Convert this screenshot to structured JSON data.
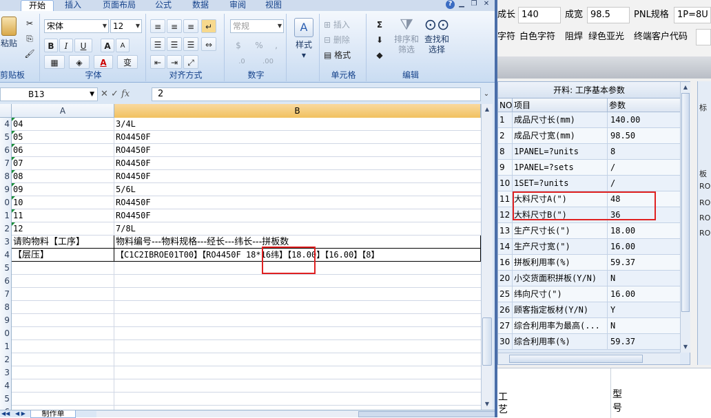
{
  "excel": {
    "ribbon_tabs": [
      "开始",
      "插入",
      "页面布局",
      "公式",
      "数据",
      "审阅",
      "视图"
    ],
    "clipboard": {
      "paste": "粘贴",
      "group": "剪贴板"
    },
    "font": {
      "name": "宋体",
      "size": "12",
      "bold": "B",
      "italic": "I",
      "underline": "U",
      "grow": "A",
      "shrink": "A",
      "font_color": "A",
      "phonetic": "变",
      "group": "字体"
    },
    "alignment": {
      "group": "对齐方式"
    },
    "number": {
      "format": "常规",
      "percent": "%",
      "comma": ",",
      "inc_decimal": ".0",
      "dec_decimal": ".00",
      "group": "数字"
    },
    "styles": {
      "label": "样式"
    },
    "cells": {
      "insert": "插入",
      "delete": "删除",
      "format": "格式",
      "group": "单元格"
    },
    "editing": {
      "sum": "Σ",
      "sort_filter": "排序和筛选",
      "find_select": "查找和选择",
      "group": "编辑"
    },
    "formula_bar": {
      "name_box": "B13",
      "fx": "fx",
      "value": "2"
    },
    "columns": [
      "A",
      "B"
    ],
    "rows": [
      {
        "num": "4",
        "a": "04",
        "b": "3/4L"
      },
      {
        "num": "5",
        "a": "05",
        "b": "RO4450F"
      },
      {
        "num": "6",
        "a": "06",
        "b": "RO4450F"
      },
      {
        "num": "7",
        "a": "07",
        "b": "RO4450F"
      },
      {
        "num": "8",
        "a": "08",
        "b": "RO4450F"
      },
      {
        "num": "9",
        "a": "09",
        "b": "5/6L"
      },
      {
        "num": "0",
        "a": "10",
        "b": "RO4450F"
      },
      {
        "num": "1",
        "a": "11",
        "b": "RO4450F"
      },
      {
        "num": "2",
        "a": "12",
        "b": "7/8L"
      },
      {
        "num": "3",
        "a": "请购物料【工序】",
        "b": "物料编号---物料规格---经长---纬长---拼板数"
      },
      {
        "num": "4",
        "a": "【层压】",
        "b": "【C1C2IBROE01T00】【RO4450F 18*16纬】【18.00】【16.00】【8】"
      },
      {
        "num": "5",
        "a": "",
        "b": ""
      },
      {
        "num": "6",
        "a": "",
        "b": ""
      },
      {
        "num": "7",
        "a": "",
        "b": ""
      },
      {
        "num": "8",
        "a": "",
        "b": ""
      },
      {
        "num": "9",
        "a": "",
        "b": ""
      },
      {
        "num": "0",
        "a": "",
        "b": ""
      },
      {
        "num": "1",
        "a": "",
        "b": ""
      },
      {
        "num": "2",
        "a": "",
        "b": ""
      },
      {
        "num": "3",
        "a": "",
        "b": ""
      },
      {
        "num": "4",
        "a": "",
        "b": ""
      },
      {
        "num": "5",
        "a": "",
        "b": ""
      },
      {
        "num": "6",
        "a": "",
        "b": ""
      }
    ],
    "sheet_tab": "制作单"
  },
  "right": {
    "fields": [
      {
        "label": "成长",
        "value": "140"
      },
      {
        "label": "成宽",
        "value": "98.5"
      },
      {
        "label": "PNL规格",
        "value": "1P=8U"
      }
    ],
    "row2": {
      "label1": "字符",
      "value1": "白色字符",
      "label2": "阻焊",
      "value2": "绿色亚光",
      "label3": "终端客户代码",
      "value3": ""
    },
    "panel_title": "开料: 工序基本参数",
    "headers": {
      "no": "NO",
      "item": "项目",
      "param": "参数"
    },
    "params": [
      {
        "no": "1",
        "item": "成品尺寸长(mm)",
        "value": "140.00"
      },
      {
        "no": "2",
        "item": "成品尺寸宽(mm)",
        "value": "98.50"
      },
      {
        "no": "8",
        "item": "1PANEL=?units",
        "value": "8"
      },
      {
        "no": "9",
        "item": "1PANEL=?sets",
        "value": "/"
      },
      {
        "no": "10",
        "item": "1SET=?units",
        "value": "/"
      },
      {
        "no": "11",
        "item": "大料尺寸A(\")",
        "value": "48"
      },
      {
        "no": "12",
        "item": "大料尺寸B(\")",
        "value": "36"
      },
      {
        "no": "13",
        "item": "生产尺寸长(\")",
        "value": "18.00"
      },
      {
        "no": "14",
        "item": "生产尺寸宽(\")",
        "value": "16.00"
      },
      {
        "no": "16",
        "item": "拼板利用率(%)",
        "value": "59.37"
      },
      {
        "no": "20",
        "item": "小交货面积拼板(Y/N)",
        "value": "N"
      },
      {
        "no": "25",
        "item": "纬向尺寸(\")",
        "value": "16.00"
      },
      {
        "no": "26",
        "item": "顾客指定板材(Y/N)",
        "value": "Y"
      },
      {
        "no": "27",
        "item": "综合利用率为最高(...",
        "value": "N"
      },
      {
        "no": "30",
        "item": "综合利用率(%)",
        "value": "59.37"
      }
    ],
    "side_items": [
      "标",
      "板",
      "RO",
      "RO",
      "RO",
      "RO"
    ],
    "bottom": {
      "gong": "工",
      "yi": "艺",
      "xing": "型",
      "hao": "号"
    }
  }
}
